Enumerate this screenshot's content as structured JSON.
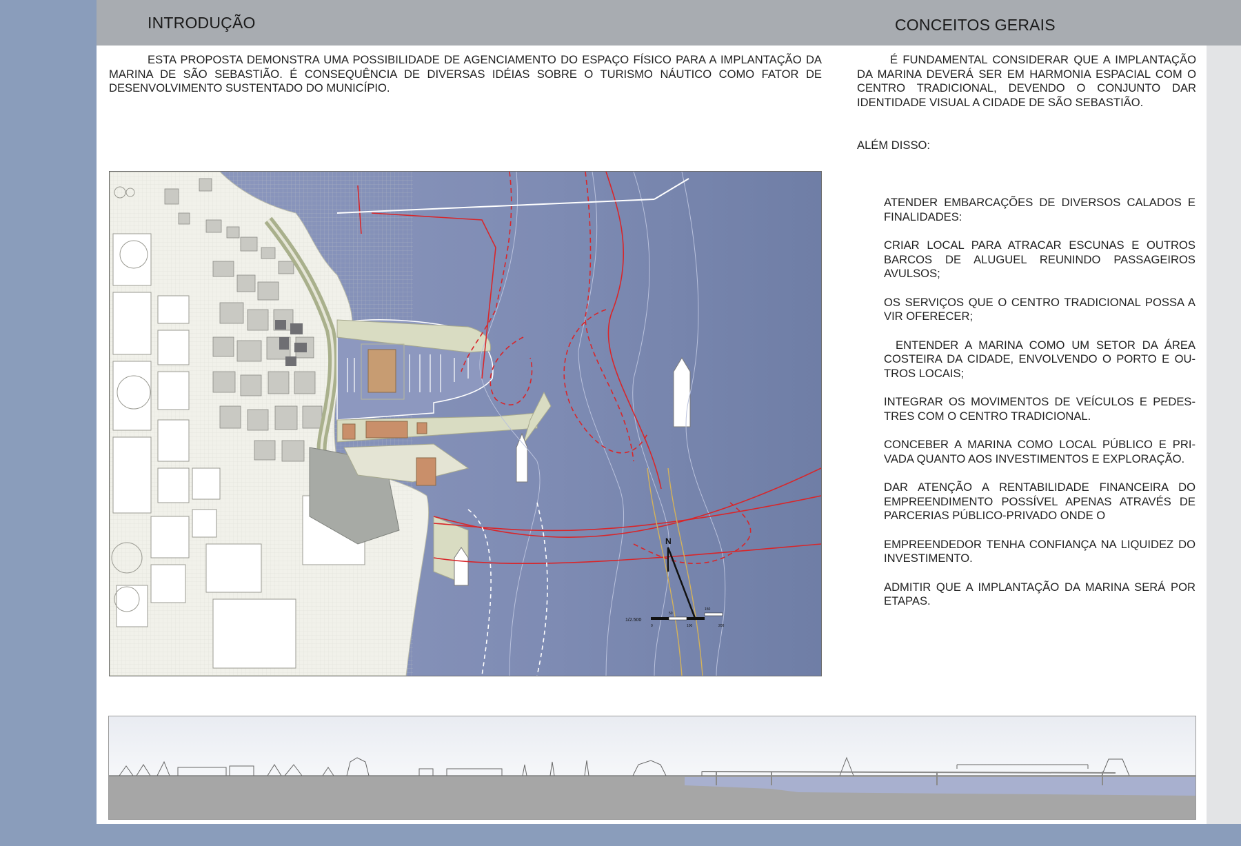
{
  "header": {
    "left_title": "INTRODUÇÃO",
    "right_title": "CONCEITOS GERAIS"
  },
  "intro": {
    "paragraph": "ESTA PROPOSTA DEMONSTRA UMA POSSIBILIDADE DE AGENCIAMENTO DO ESPAÇO FÍSICO PARA A IMPLANTAÇÃO DA MARINA DE SÃO SEBASTIÃO. É CONSEQUÊNCIA DE DIVERSAS IDÉIAS SOBRE O TURISMO NÁUTICO COMO FATOR DE DESENVOLVIMENTO SUSTENTADO DO MUNICÍPIO."
  },
  "concepts": {
    "paragraph": "É FUNDAMENTAL CONSIDERAR QUE A IMPLANTAÇÃO DA MARINA DEVERÁ SER EM HARMONIA ESPACIAL COM O CENTRO TRADICIONAL, DEVENDO O CONJUNTO DAR IDENTIDADE VISUAL A CIDADE DE SÃO SEBASTIÃO.",
    "alem": "ALÉM DISSO:",
    "items": [
      "ATENDER EMBARCAÇÕES DE DIVERSOS CALADOS E FINALIDADES:",
      "CRIAR LOCAL PARA ATRACAR ESCUNAS E OUTROS BARCOS DE ALUGUEL REUNINDO PASSAGEIROS AVULSOS;",
      "OS SERVIÇOS QUE O CENTRO TRADICIONAL POSSA A VIR OFERECER;",
      "ENTENDER A MARINA COMO UM SETOR DA ÁREA COSTEIRA DA CIDADE, ENVOLVENDO O PORTO E OU-TROS LOCAIS;",
      "INTEGRAR OS MOVIMENTOS DE VEÍCULOS E PEDES-TRES COM O CENTRO TRADICIONAL.",
      "CONCEBER A MARINA COMO LOCAL PÚBLICO E PRI-VADA QUANTO AOS INVESTIMENTOS E EXPLORAÇÃO.",
      "DAR ATENÇÃO A RENTABILIDADE FINANCEIRA DO EMPREENDIMENTO POSSÍVEL APENAS ATRAVÉS DE PARCERIAS PÚBLICO-PRIVADO ONDE O",
      "EMPREENDEDOR TENHA CONFIANÇA NA LIQUIDEZ DO INVESTIMENTO.",
      "ADMITIR QUE A IMPLANTAÇÃO DA MARINA SERÁ POR ETAPAS."
    ]
  },
  "site_plan": {
    "scale_label": "1/2.500",
    "north_label": "N",
    "scale_ticks": [
      "0",
      "50",
      "100",
      "150",
      "200"
    ]
  }
}
